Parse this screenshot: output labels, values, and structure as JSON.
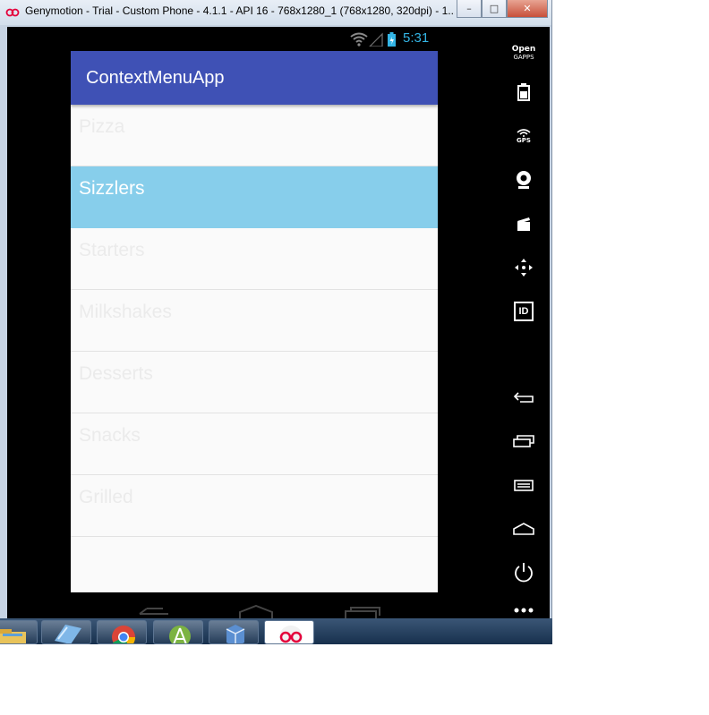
{
  "window": {
    "title": "Genymotion - Trial - Custom Phone - 4.1.1 - API 16 - 768x1280_1 (768x1280, 320dpi) - 1...",
    "buttons": [
      "minimize",
      "maximize",
      "close"
    ]
  },
  "status_bar": {
    "time": "5:31",
    "icons": [
      "wifi-icon",
      "signal-icon",
      "battery-icon"
    ]
  },
  "app": {
    "title": "ContextMenuApp",
    "items": [
      {
        "label": "Pizza",
        "selected": false
      },
      {
        "label": "Sizzlers",
        "selected": true
      },
      {
        "label": "Starters",
        "selected": false
      },
      {
        "label": "Milkshakes",
        "selected": false
      },
      {
        "label": "Desserts",
        "selected": false
      },
      {
        "label": "Snacks",
        "selected": false
      },
      {
        "label": "Grilled",
        "selected": false
      }
    ],
    "selected_color": "#87ceeb",
    "appbar_color": "#3f51b5"
  },
  "side_panel": {
    "open_gapps_line1": "Open",
    "open_gapps_line2": "GAPPS",
    "gps_label": "GPS",
    "id_label": "ID",
    "tools": [
      "battery-icon",
      "gps-icon",
      "webcam-icon",
      "video-capture-icon",
      "dpad-icon",
      "device-id-icon"
    ],
    "nav": [
      "back-icon",
      "recent-apps-icon",
      "menu-icon",
      "home-icon",
      "power-icon",
      "more-icon"
    ]
  },
  "taskbar": {
    "apps": [
      "file-explorer-icon",
      "notepad-icon",
      "chrome-icon",
      "android-studio-icon",
      "virtualbox-icon",
      "genymotion-icon"
    ]
  }
}
